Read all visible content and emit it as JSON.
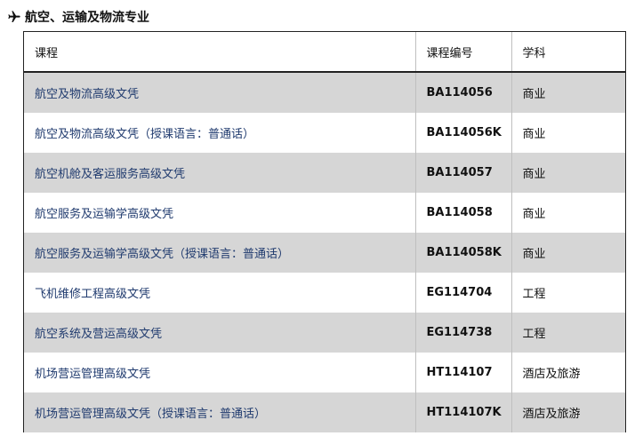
{
  "heading": {
    "icon": "airplane-icon",
    "title": "航空、运输及物流专业"
  },
  "table": {
    "columns": [
      "课程",
      "课程编号",
      "学科"
    ],
    "rows": [
      {
        "name": "航空及物流高级文凭",
        "code": "BA114056",
        "subject": "商业"
      },
      {
        "name": "航空及物流高级文凭（授课语言：普通话）",
        "code": "BA114056K",
        "subject": "商业"
      },
      {
        "name": "航空机舱及客运服务高级文凭",
        "code": "BA114057",
        "subject": "商业"
      },
      {
        "name": "航空服务及运输学高级文凭",
        "code": "BA114058",
        "subject": "商业"
      },
      {
        "name": "航空服务及运输学高级文凭（授课语言：普通话）",
        "code": "BA114058K",
        "subject": "商业"
      },
      {
        "name": "飞机维修工程高级文凭",
        "code": "EG114704",
        "subject": "工程"
      },
      {
        "name": "航空系统及营运高级文凭",
        "code": "EG114738",
        "subject": "工程"
      },
      {
        "name": "机场营运管理高级文凭",
        "code": "HT114107",
        "subject": "酒店及旅游"
      },
      {
        "name": "机场营运管理高级文凭（授课语言：普通话）",
        "code": "HT114107K",
        "subject": "酒店及旅游"
      }
    ],
    "colors": {
      "shade": "#d6d6d6",
      "link_text": "#1f3a6e"
    }
  }
}
